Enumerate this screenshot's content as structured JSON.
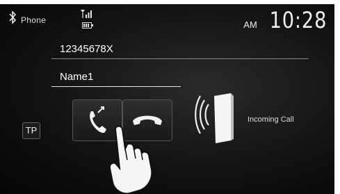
{
  "status_bar": {
    "source": "Phone",
    "clock": {
      "ampm": "AM",
      "time": "10:28"
    }
  },
  "call": {
    "number": "12345678X",
    "name": "Name1",
    "status": "Incoming Call"
  },
  "buttons": {
    "tp": "TP"
  },
  "icons": [
    "bluetooth-icon",
    "signal-icon",
    "battery-icon",
    "answer-phone-icon",
    "reject-phone-icon",
    "incoming-call-icon",
    "hand-pointer-icon"
  ]
}
